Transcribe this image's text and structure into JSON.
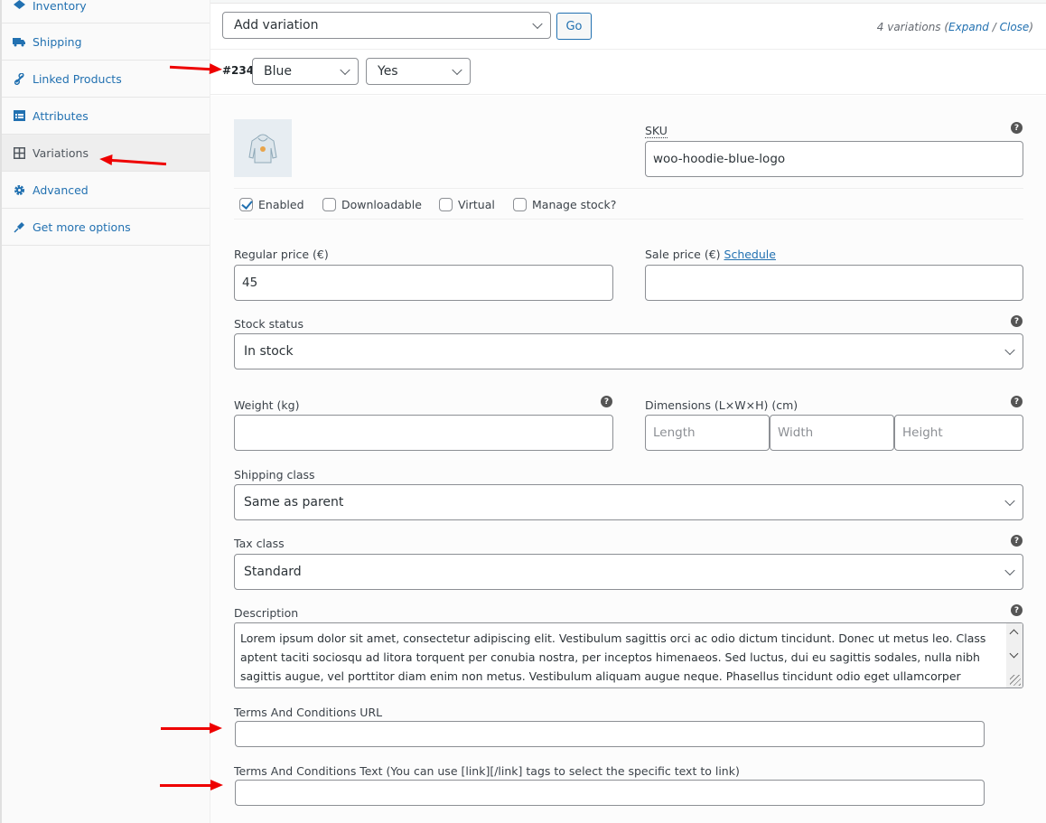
{
  "sidebar": {
    "items": [
      {
        "label": "Inventory",
        "icon": "inventory-icon",
        "active": false
      },
      {
        "label": "Shipping",
        "icon": "truck-icon",
        "active": false
      },
      {
        "label": "Linked Products",
        "icon": "link-icon",
        "active": false
      },
      {
        "label": "Attributes",
        "icon": "attributes-icon",
        "active": false
      },
      {
        "label": "Variations",
        "icon": "grid-icon",
        "active": true
      },
      {
        "label": "Advanced",
        "icon": "gear-icon",
        "active": false
      },
      {
        "label": "Get more options",
        "icon": "plugin-icon",
        "active": false
      }
    ]
  },
  "toolbar": {
    "action_select": "Add variation",
    "go_label": "Go",
    "count_text": "4 variations (",
    "expand_label": "Expand",
    "separator": " / ",
    "close_label": "Close",
    "count_end": ")"
  },
  "variation": {
    "id": "#234",
    "attribute_1": "Blue",
    "attribute_2": "Yes",
    "sku_label": "SKU",
    "sku_value": "woo-hoodie-blue-logo",
    "checkboxes": [
      {
        "label": "Enabled",
        "checked": true
      },
      {
        "label": "Downloadable",
        "checked": false
      },
      {
        "label": "Virtual",
        "checked": false
      },
      {
        "label": "Manage stock?",
        "checked": false
      }
    ],
    "regular_price_label": "Regular price (€)",
    "regular_price_value": "45",
    "sale_price_label": "Sale price (€)",
    "schedule_link": "Schedule",
    "sale_price_value": "",
    "stock_status_label": "Stock status",
    "stock_status_value": "In stock",
    "weight_label": "Weight (kg)",
    "weight_value": "",
    "dimensions_label": "Dimensions (L×W×H) (cm)",
    "length_placeholder": "Length",
    "width_placeholder": "Width",
    "height_placeholder": "Height",
    "shipping_class_label": "Shipping class",
    "shipping_class_value": "Same as parent",
    "tax_class_label": "Tax class",
    "tax_class_value": "Standard",
    "description_label": "Description",
    "description_value": "Lorem ipsum dolor sit amet, consectetur adipiscing elit. Vestibulum sagittis orci ac odio dictum tincidunt. Donec ut metus leo. Class aptent taciti sociosqu ad litora torquent per conubia nostra, per inceptos himenaeos. Sed luctus, dui eu sagittis sodales, nulla nibh sagittis augue, vel porttitor diam enim non metus. Vestibulum aliquam augue neque. Phasellus tincidunt odio eget ullamcorper efficitur. Cras",
    "terms_url_label": "Terms And Conditions URL",
    "terms_url_value": "",
    "terms_text_label": "Terms And Conditions Text (You can use [link][/link] tags to select the specific text to link)",
    "terms_text_value": ""
  },
  "colors": {
    "link": "#2271b1",
    "annotation_arrow": "#ee0000"
  }
}
